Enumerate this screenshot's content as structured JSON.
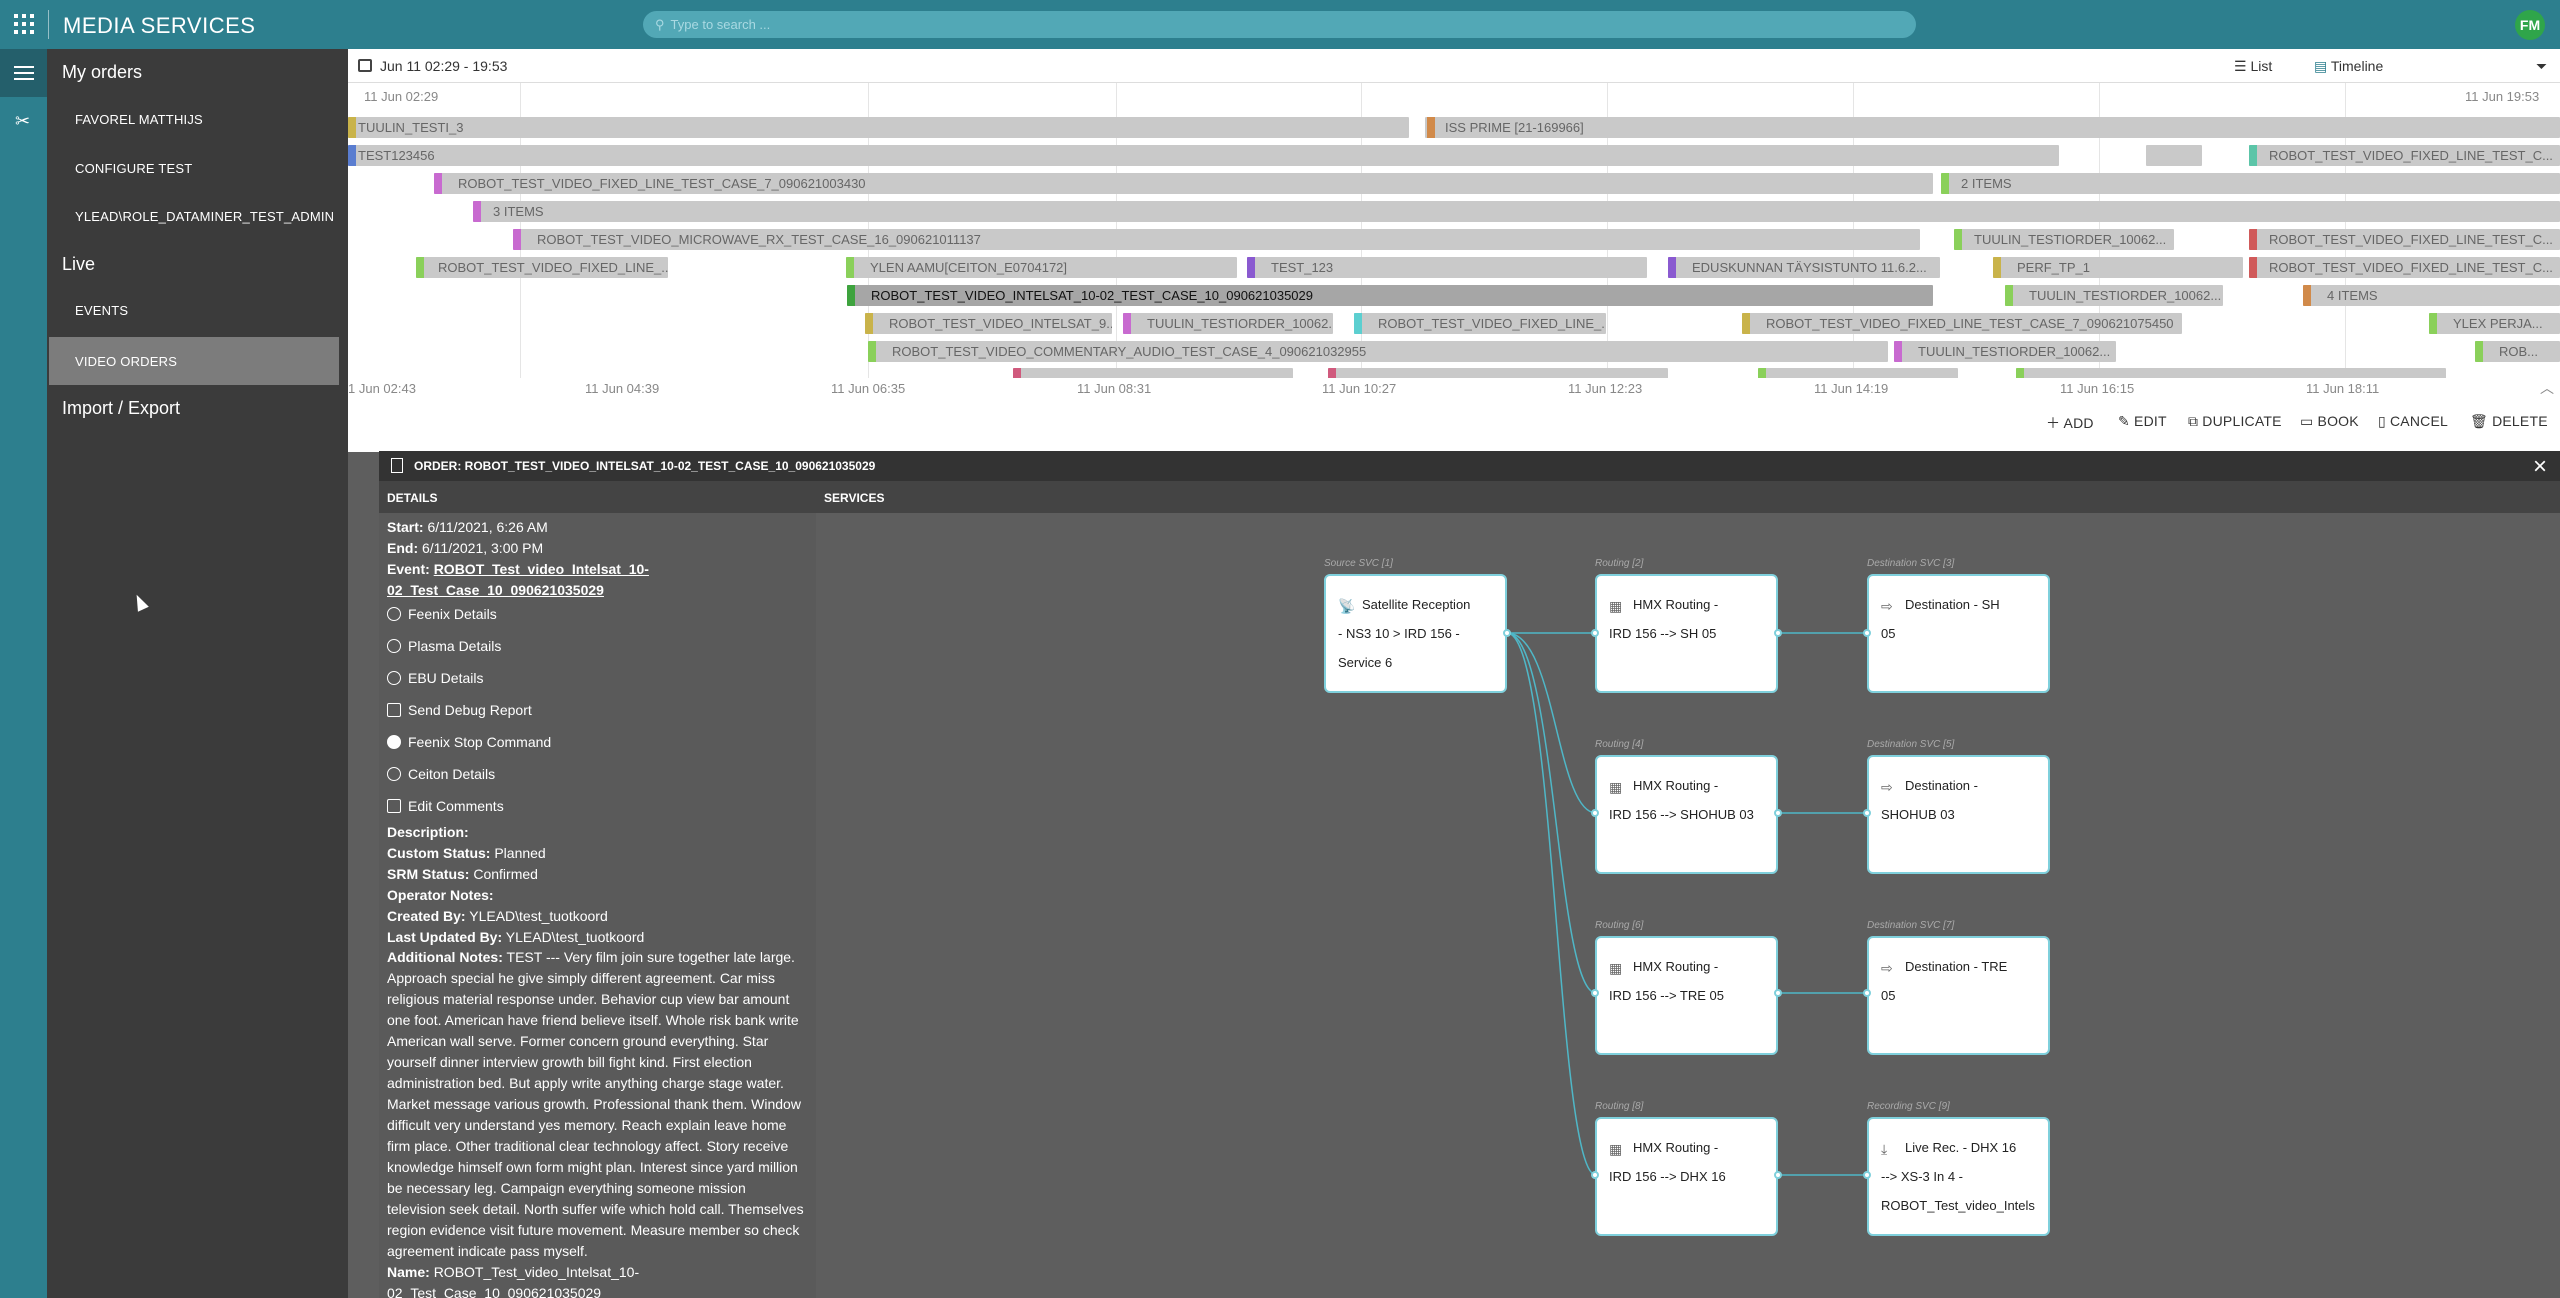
{
  "topbar": {
    "title": "MEDIA SERVICES",
    "search_placeholder": "Type to search ...",
    "avatar": "FM"
  },
  "sidenav": {
    "my_orders": "My orders",
    "items": [
      "FAVOREL MATTHIJS",
      "CONFIGURE TEST",
      "YLEAD\\ROLE_DATAMINER_TEST_ADMIN"
    ],
    "live": "Live",
    "live_items": [
      "EVENTS",
      "VIDEO ORDERS"
    ],
    "import_export": "Import / Export"
  },
  "timeline": {
    "range": "Jun 11 02:29 - 19:53",
    "view_list": "List",
    "view_timeline": "Timeline",
    "start_label": "11 Jun 02:29",
    "end_label": "11 Jun 19:53",
    "axis": [
      "1 Jun 02:43",
      "11 Jun 04:39",
      "11 Jun 06:35",
      "11 Jun 08:31",
      "11 Jun 10:27",
      "11 Jun 12:23",
      "11 Jun 14:19",
      "11 Jun 16:15",
      "11 Jun 18:11"
    ],
    "bars": [
      "TUULIN_TESTI_3",
      "ISS PRIME [21-169966]",
      "TEST123456",
      "ROBOT_TEST_VIDEO_FIXED_LINE_TEST_C...",
      "ROBOT_TEST_VIDEO_FIXED_LINE_TEST_CASE_7_090621003430",
      "2 ITEMS",
      "3 ITEMS",
      "ROBOT_TEST_VIDEO_MICROWAVE_RX_TEST_CASE_16_090621011137",
      "TUULIN_TESTIORDER_10062...",
      "ROBOT_TEST_VIDEO_FIXED_LINE_TEST_C...",
      "ROBOT_TEST_VIDEO_FIXED_LINE_...",
      "YLEN AAMU[CEITON_E0704172]",
      "TEST_123",
      "EDUSKUNNAN TÄYSISTUNTO 11.6.2...",
      "PERF_TP_1",
      "ROBOT_TEST_VIDEO_FIXED_LINE_TEST_C...",
      "ROBOT_TEST_VIDEO_INTELSAT_10-02_TEST_CASE_10_090621035029",
      "TUULIN_TESTIORDER_10062...",
      "4 ITEMS",
      "ROBOT_TEST_VIDEO_INTELSAT_9...",
      "TUULIN_TESTIORDER_10062...",
      "ROBOT_TEST_VIDEO_FIXED_LINE_...",
      "ROBOT_TEST_VIDEO_FIXED_LINE_TEST_CASE_7_090621075450",
      "YLEX PERJA...",
      "ROBOT_TEST_VIDEO_COMMENTARY_AUDIO_TEST_CASE_4_090621032955",
      "TUULIN_TESTIORDER_10062...",
      "ROB..."
    ]
  },
  "actions": {
    "add": "ADD",
    "edit": "EDIT",
    "duplicate": "DUPLICATE",
    "book": "BOOK",
    "cancel": "CANCEL",
    "delete": "DELETE"
  },
  "order": {
    "title": "ORDER: ROBOT_TEST_VIDEO_INTELSAT_10-02_TEST_CASE_10_090621035029",
    "details_header": "DETAILS",
    "services_header": "SERVICES",
    "start_label": "Start:",
    "start": "6/11/2021, 6:26 AM",
    "end_label": "End:",
    "end": "6/11/2021, 3:00 PM",
    "event_label": "Event:",
    "event_1": "ROBOT_Test_video_Intelsat_10-",
    "event_2": "02_Test_Case_10_090621035029",
    "links": [
      "Feenix Details",
      "Plasma Details",
      "EBU Details",
      "Send Debug Report",
      "Feenix Stop Command",
      "Ceiton Details",
      "Edit Comments"
    ],
    "description_label": "Description:",
    "custom_status_label": "Custom Status:",
    "custom_status": "Planned",
    "srm_status_label": "SRM Status:",
    "srm_status": "Confirmed",
    "operator_notes_label": "Operator Notes:",
    "created_by_label": "Created By:",
    "created_by": "YLEAD\\test_tuotkoord",
    "updated_by_label": "Last Updated By:",
    "updated_by": "YLEAD\\test_tuotkoord",
    "additional_label": "Additional Notes:",
    "additional": "TEST --- Very film join sure together late large. Approach special he give simply different agreement. Car miss religious material response under. Behavior cup view bar amount one foot. American have friend believe itself. Whole risk bank write American wall serve. Former concern ground everything. Star yourself dinner interview growth bill fight kind. First election administration bed. But apply write anything charge stage water. Market message various growth. Professional thank them. Window difficult very understand yes memory. Reach explain leave home firm place. Other traditional clear technology affect. Story receive knowledge himself own form might plan. Interest since yard million be necessary leg. Campaign everything someone mission television seek detail. North suffer wife which hold call. Themselves region evidence visit future movement. Measure member so check agreement indicate pass myself.",
    "name_label": "Name:",
    "name_1": "ROBOT_Test_video_Intelsat_10-",
    "name_2": "02_Test_Case_10_090621035029"
  },
  "services": [
    {
      "cap": "Source SVC [1]",
      "lines": [
        "Satellite Reception",
        "- NS3 10 > IRD 156 -",
        "Service 6"
      ],
      "icon": "satellite-icon"
    },
    {
      "cap": "Routing [2]",
      "lines": [
        "HMX Routing -",
        "IRD 156 --> SH 05"
      ],
      "icon": "routing-icon"
    },
    {
      "cap": "Destination SVC [3]",
      "lines": [
        "Destination - SH",
        "05"
      ],
      "icon": "destination-icon"
    },
    {
      "cap": "Routing [4]",
      "lines": [
        "HMX Routing -",
        "IRD 156 --> SHOHUB 03"
      ],
      "icon": "routing-icon"
    },
    {
      "cap": "Destination SVC [5]",
      "lines": [
        "Destination -",
        "SHOHUB 03"
      ],
      "icon": "destination-icon"
    },
    {
      "cap": "Routing [6]",
      "lines": [
        "HMX Routing -",
        "IRD 156 --> TRE 05"
      ],
      "icon": "routing-icon"
    },
    {
      "cap": "Destination SVC [7]",
      "lines": [
        "Destination - TRE",
        "05"
      ],
      "icon": "destination-icon"
    },
    {
      "cap": "Routing [8]",
      "lines": [
        "HMX Routing -",
        "IRD 156 --> DHX 16"
      ],
      "icon": "routing-icon"
    },
    {
      "cap": "Recording SVC [9]",
      "lines": [
        "Live Rec. - DHX 16",
        "--> XS-3 In 4 -",
        "ROBOT_Test_video_Intels"
      ],
      "icon": "recording-icon"
    }
  ]
}
